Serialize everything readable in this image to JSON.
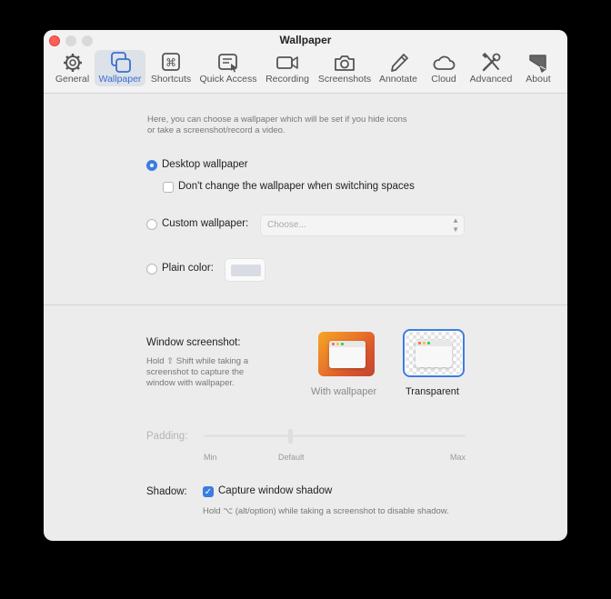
{
  "window": {
    "title": "Wallpaper"
  },
  "toolbar": {
    "items": [
      {
        "label": "General",
        "icon": "gear-icon"
      },
      {
        "label": "Wallpaper",
        "icon": "wallpaper-icon",
        "selected": true
      },
      {
        "label": "Shortcuts",
        "icon": "command-key-icon"
      },
      {
        "label": "Quick Access",
        "icon": "quick-access-icon"
      },
      {
        "label": "Recording",
        "icon": "video-camera-icon"
      },
      {
        "label": "Screenshots",
        "icon": "camera-icon"
      },
      {
        "label": "Annotate",
        "icon": "pencil-icon"
      },
      {
        "label": "Cloud",
        "icon": "cloud-icon"
      },
      {
        "label": "Advanced",
        "icon": "wrench-screwdriver-icon"
      },
      {
        "label": "About",
        "icon": "about-icon"
      }
    ]
  },
  "wallpaper": {
    "description_line1": "Here, you can choose a wallpaper which will be set if you hide icons",
    "description_line2": "or take a screenshot/record a video.",
    "desktop_label": "Desktop wallpaper",
    "desktop_selected": true,
    "dont_change_label": "Don't change the wallpaper when switching spaces",
    "dont_change_checked": false,
    "custom_label": "Custom wallpaper:",
    "custom_placeholder": "Choose...",
    "plain_label": "Plain color:",
    "plain_color": "#d9dde3"
  },
  "window_screenshot": {
    "label": "Window screenshot:",
    "hint_line1": "Hold ⇧ Shift while taking a",
    "hint_line2": "screenshot to capture the",
    "hint_line3": "window with wallpaper.",
    "option_with_wallpaper": "With wallpaper",
    "option_transparent": "Transparent",
    "selected": "Transparent"
  },
  "padding": {
    "label": "Padding:",
    "min_label": "Min",
    "default_label": "Default",
    "max_label": "Max",
    "value_fraction": 0.33,
    "enabled": false
  },
  "shadow": {
    "label": "Shadow:",
    "checkbox_label": "Capture window shadow",
    "checked": true,
    "hint": "Hold ⌥ (alt/option) while taking a screenshot to disable shadow."
  },
  "colors": {
    "accent": "#3b7de0",
    "window_bg": "#ececec",
    "close_button": "#ff5f57"
  }
}
